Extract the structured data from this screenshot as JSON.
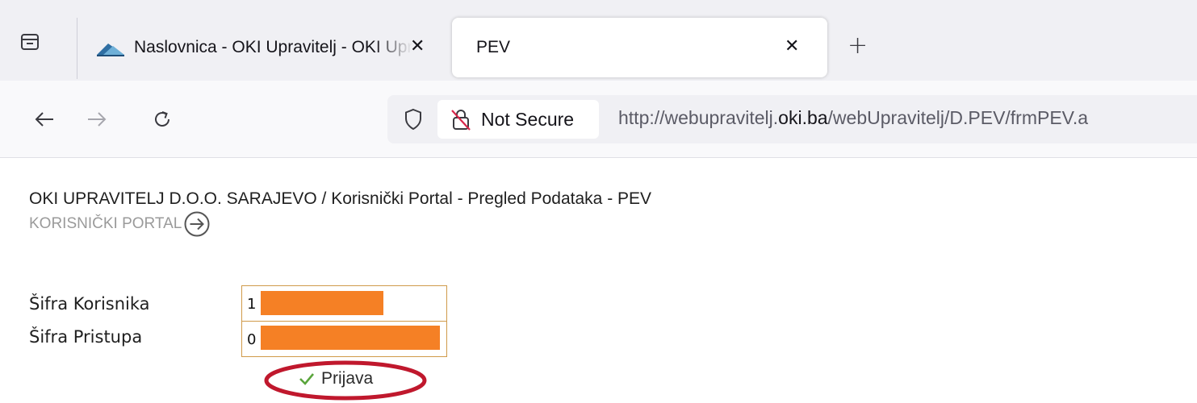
{
  "browser": {
    "tabs": [
      {
        "title": "Naslovnica - OKI Upravitelj - OKI Upravitelj",
        "active": false,
        "close": "✕"
      },
      {
        "title": "PEV",
        "active": true,
        "close": "✕"
      }
    ],
    "new_tab": "+",
    "url": {
      "security_label": "Not Secure",
      "prefix": "http://webupravitelj.",
      "host": "oki.ba",
      "path": "/webUpravitelj/D.PEV/frmPEV.a"
    }
  },
  "page": {
    "breadcrumb": "OKI UPRAVITELJ D.O.O. SARAJEVO / Korisnički Portal - Pregled Podataka - PEV",
    "portal_link": "KORISNIČKI PORTAL",
    "form": {
      "user_label": "Šifra Korisnika",
      "user_value": "1",
      "pass_label": "Šifra Pristupa",
      "pass_value": "0",
      "submit_label": "Prijava"
    }
  },
  "colors": {
    "redaction": "#f58025",
    "annotation": "#c0182d",
    "input_border": "#d09a4a",
    "check": "#5aa53c"
  }
}
